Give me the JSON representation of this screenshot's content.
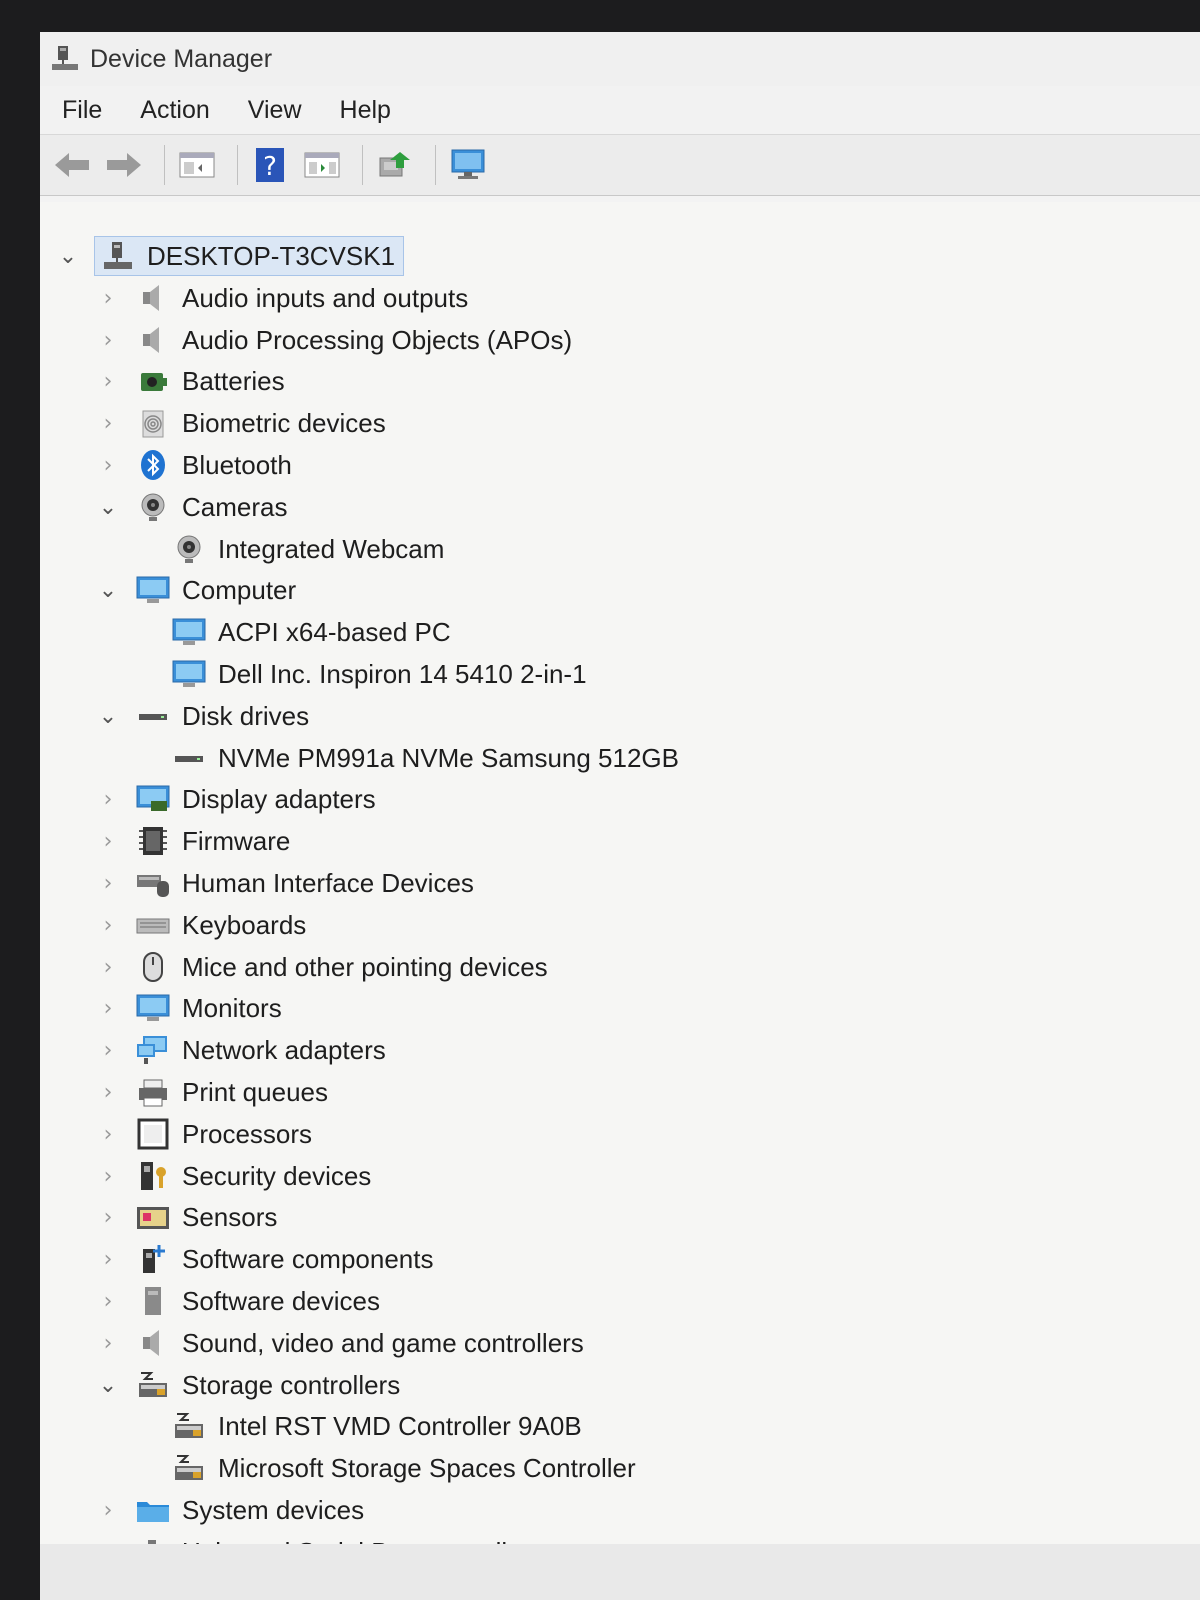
{
  "window": {
    "title": "Device Manager"
  },
  "menu": [
    "File",
    "Action",
    "View",
    "Help"
  ],
  "toolbar": [
    "back-arrow-icon",
    "forward-arrow-icon",
    "show-hide-console-tree-icon",
    "help-icon",
    "properties-icon",
    "update-driver-icon",
    "scan-hardware-icon"
  ],
  "tree": {
    "root": "DESKTOP-T3CVSK1",
    "items": [
      {
        "label": "Audio inputs and outputs",
        "icon": "speaker-icon",
        "expanded": false
      },
      {
        "label": "Audio Processing Objects (APOs)",
        "icon": "speaker-icon",
        "expanded": false
      },
      {
        "label": "Batteries",
        "icon": "battery-icon",
        "expanded": false
      },
      {
        "label": "Biometric devices",
        "icon": "fingerprint-icon",
        "expanded": false
      },
      {
        "label": "Bluetooth",
        "icon": "bluetooth-icon",
        "expanded": false
      },
      {
        "label": "Cameras",
        "icon": "camera-icon",
        "expanded": true,
        "children": [
          "Integrated Webcam"
        ]
      },
      {
        "label": "Computer",
        "icon": "computer-icon",
        "expanded": true,
        "children": [
          "ACPI x64-based PC",
          "Dell Inc. Inspiron 14 5410 2-in-1"
        ]
      },
      {
        "label": "Disk drives",
        "icon": "disk-drive-icon",
        "expanded": true,
        "children": [
          "NVMe PM991a NVMe Samsung 512GB"
        ]
      },
      {
        "label": "Display adapters",
        "icon": "display-adapter-icon",
        "expanded": false
      },
      {
        "label": "Firmware",
        "icon": "firmware-chip-icon",
        "expanded": false
      },
      {
        "label": "Human Interface Devices",
        "icon": "hid-icon",
        "expanded": false
      },
      {
        "label": "Keyboards",
        "icon": "keyboard-icon",
        "expanded": false
      },
      {
        "label": "Mice and other pointing devices",
        "icon": "mouse-icon",
        "expanded": false
      },
      {
        "label": "Monitors",
        "icon": "monitor-icon",
        "expanded": false
      },
      {
        "label": "Network adapters",
        "icon": "network-adapter-icon",
        "expanded": false
      },
      {
        "label": "Print queues",
        "icon": "printer-icon",
        "expanded": false
      },
      {
        "label": "Processors",
        "icon": "processor-icon",
        "expanded": false
      },
      {
        "label": "Security devices",
        "icon": "security-key-icon",
        "expanded": false
      },
      {
        "label": "Sensors",
        "icon": "sensor-icon",
        "expanded": false
      },
      {
        "label": "Software components",
        "icon": "software-component-icon",
        "expanded": false
      },
      {
        "label": "Software devices",
        "icon": "software-device-icon",
        "expanded": false
      },
      {
        "label": "Sound, video and game controllers",
        "icon": "speaker-icon",
        "expanded": false
      },
      {
        "label": "Storage controllers",
        "icon": "storage-controller-icon",
        "expanded": true,
        "children": [
          "Intel RST VMD Controller 9A0B",
          "Microsoft Storage Spaces Controller"
        ]
      },
      {
        "label": "System devices",
        "icon": "system-folder-icon",
        "expanded": false
      },
      {
        "label": "Universal Serial Bus controllers",
        "icon": "usb-icon",
        "expanded": false
      }
    ]
  },
  "colors": {
    "accent": "#2f7fd6",
    "selection": "#dbe7f5",
    "tree_background": "#f6f6f4"
  }
}
